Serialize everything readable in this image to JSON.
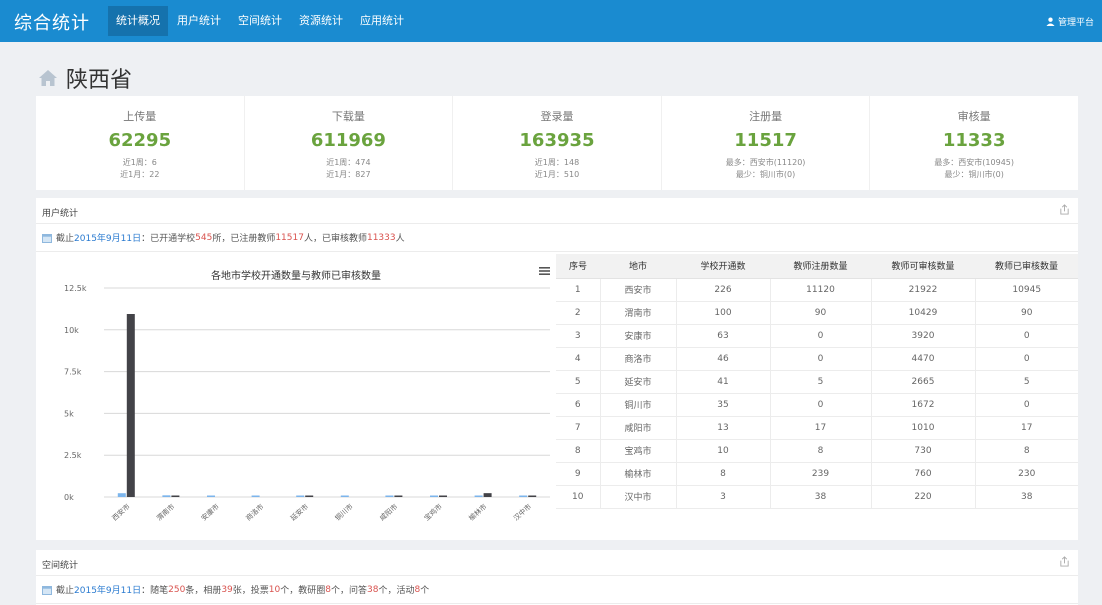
{
  "header": {
    "brand": "综合统计",
    "nav": [
      {
        "label": "统计概况",
        "active": true
      },
      {
        "label": "用户统计",
        "active": false
      },
      {
        "label": "空间统计",
        "active": false
      },
      {
        "label": "资源统计",
        "active": false
      },
      {
        "label": "应用统计",
        "active": false
      }
    ],
    "admin_label": "管理平台"
  },
  "page": {
    "title": "陕西省"
  },
  "stats": [
    {
      "label": "上传量",
      "value": "62295",
      "sub1": "近1周：6",
      "sub2": "近1月：22"
    },
    {
      "label": "下载量",
      "value": "611969",
      "sub1": "近1周：474",
      "sub2": "近1月：827"
    },
    {
      "label": "登录量",
      "value": "163935",
      "sub1": "近1周：148",
      "sub2": "近1月：510"
    },
    {
      "label": "注册量",
      "value": "11517",
      "sub1": "最多：西安市(11120)",
      "sub2": "最少：铜川市(0)"
    },
    {
      "label": "审核量",
      "value": "11333",
      "sub1": "最多：西安市(10945)",
      "sub2": "最少：铜川市(0)"
    }
  ],
  "user_panel": {
    "title": "用户统计",
    "summary": {
      "prefix": "截止",
      "date": "2015年9月11日",
      "t1": "：已开通学校",
      "n1": "545",
      "t2": "所，已注册教师",
      "n2": "11517",
      "t3": "人，已审核教师",
      "n3": "11333",
      "t4": "人"
    }
  },
  "table": {
    "headers": [
      "序号",
      "地市",
      "学校开通数",
      "教师注册数量",
      "教师可审核数量",
      "教师已审核数量"
    ],
    "rows": [
      [
        "1",
        "西安市",
        "226",
        "11120",
        "21922",
        "10945"
      ],
      [
        "2",
        "渭南市",
        "100",
        "90",
        "10429",
        "90"
      ],
      [
        "3",
        "安康市",
        "63",
        "0",
        "3920",
        "0"
      ],
      [
        "4",
        "商洛市",
        "46",
        "0",
        "4470",
        "0"
      ],
      [
        "5",
        "延安市",
        "41",
        "5",
        "2665",
        "5"
      ],
      [
        "6",
        "铜川市",
        "35",
        "0",
        "1672",
        "0"
      ],
      [
        "7",
        "咸阳市",
        "13",
        "17",
        "1010",
        "17"
      ],
      [
        "8",
        "宝鸡市",
        "10",
        "8",
        "730",
        "8"
      ],
      [
        "9",
        "榆林市",
        "8",
        "239",
        "760",
        "230"
      ],
      [
        "10",
        "汉中市",
        "3",
        "38",
        "220",
        "38"
      ]
    ]
  },
  "chart_data": {
    "type": "bar",
    "title": "各地市学校开通数量与教师已审核数量",
    "categories": [
      "西安市",
      "渭南市",
      "安康市",
      "商洛市",
      "延安市",
      "铜川市",
      "咸阳市",
      "宝鸡市",
      "榆林市",
      "汉中市"
    ],
    "series": [
      {
        "values": [
          226,
          100,
          63,
          46,
          41,
          35,
          13,
          10,
          8,
          3
        ],
        "color": "#7cb5ec"
      },
      {
        "values": [
          10945,
          90,
          0,
          0,
          5,
          0,
          17,
          8,
          230,
          38
        ],
        "color": "#434348"
      }
    ],
    "yticks": [
      0,
      2500,
      5000,
      7500,
      10000,
      12500
    ],
    "ytick_labels": [
      "0k",
      "2.5k",
      "5k",
      "7.5k",
      "10k",
      "12.5k"
    ],
    "ylim": [
      0,
      12500
    ],
    "grid": true,
    "legend": "none"
  },
  "space_panel": {
    "title": "空间统计",
    "summary": {
      "prefix": "截止",
      "date": "2015年9月11日",
      "t1": "：随笔",
      "n1": "250",
      "t2": "条，相册",
      "n2": "39",
      "t3": "张，投票",
      "n3": "10",
      "t4": "个，教研圈",
      "n4": "8",
      "t5": "个，问答",
      "n5": "38",
      "t6": "个，活动",
      "n6": "8",
      "t7": "个"
    }
  }
}
